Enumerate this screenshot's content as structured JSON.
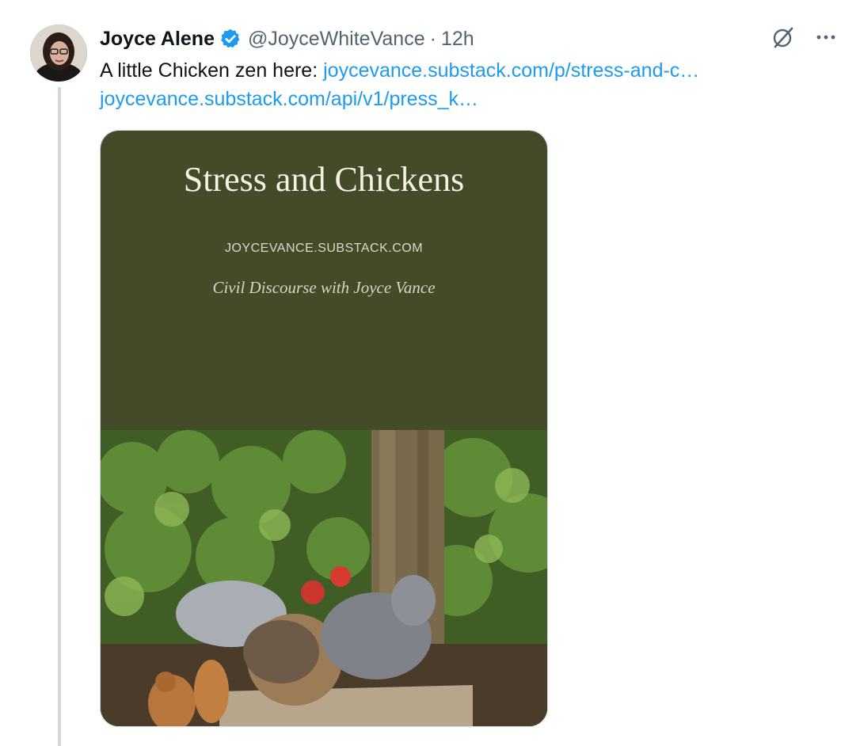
{
  "tweet": {
    "display_name": "Joyce Alene",
    "handle": "@JoyceWhiteVance",
    "separator": "·",
    "time": "12h",
    "text_prefix": "A little Chicken zen here:",
    "link1": "joycevance.substack.com/p/stress-and-c…",
    "link2": "joycevance.substack.com/api/v1/press_k…",
    "icons": {
      "verified": "verified-badge-icon",
      "grok": "grok-icon",
      "more": "more-options-icon"
    },
    "colors": {
      "link": "#1d9bf0",
      "verified": "#1d9bf0",
      "card_background": "#434b29"
    }
  },
  "card": {
    "title": "Stress and Chickens",
    "domain": "JOYCEVANCE.SUBSTACK.COM",
    "publication": "Civil Discourse with Joyce Vance"
  }
}
